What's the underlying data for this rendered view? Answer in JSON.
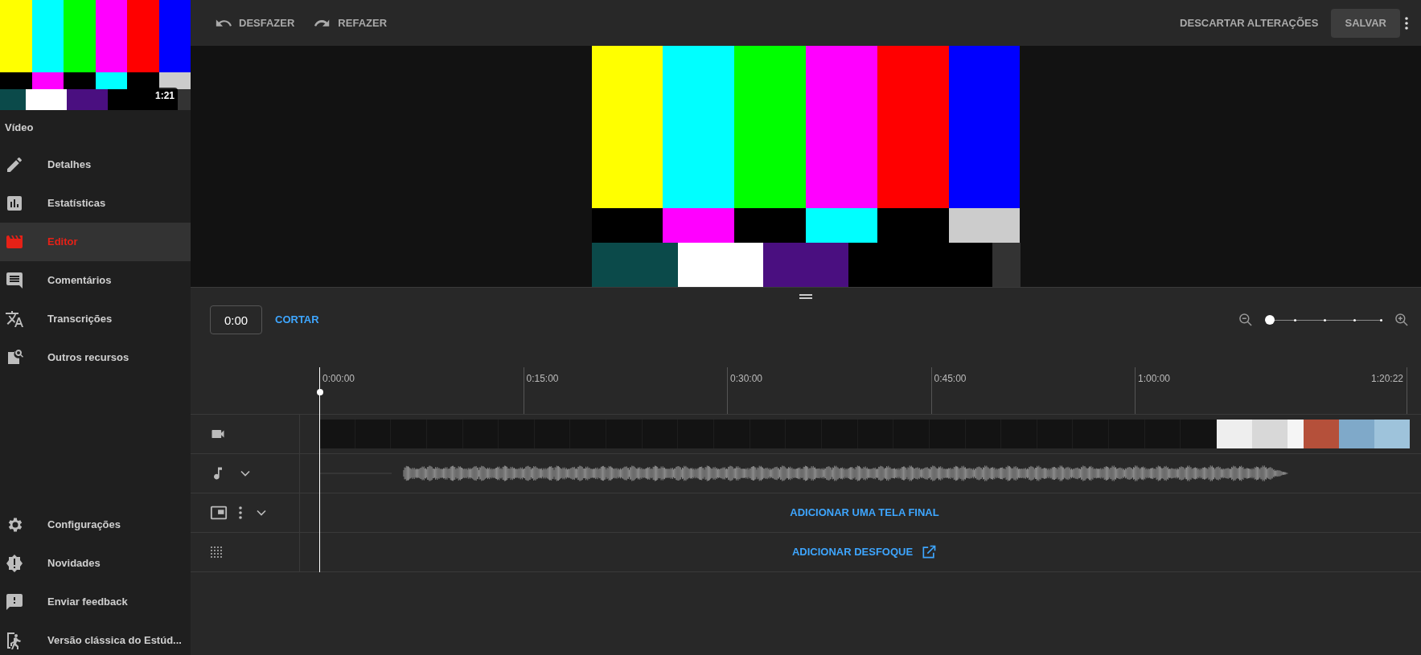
{
  "sidebar": {
    "video_thumbnail": {
      "duration": "1:21"
    },
    "section_title": "Vídeo",
    "items": [
      {
        "kind": "pencil",
        "label": "Detalhes",
        "selected": false
      },
      {
        "kind": "chart",
        "label": "Estatísticas",
        "selected": false
      },
      {
        "kind": "clapper",
        "label": "Editor",
        "selected": true
      },
      {
        "kind": "comment",
        "label": "Comentários",
        "selected": false
      },
      {
        "kind": "translate",
        "label": "Transcrições",
        "selected": false
      },
      {
        "kind": "search-doc",
        "label": "Outros recursos",
        "selected": false
      }
    ],
    "bottom_items": [
      {
        "kind": "gear",
        "label": "Configurações"
      },
      {
        "kind": "alert",
        "label": "Novidades"
      },
      {
        "kind": "feedback",
        "label": "Enviar feedback"
      },
      {
        "kind": "exit",
        "label": "Versão clássica do Estúd..."
      }
    ]
  },
  "toolbar": {
    "undo": "DESFAZER",
    "redo": "REFAZER",
    "discard": "DESCARTAR ALTERAÇÕES",
    "save": "SALVAR"
  },
  "timeline_controls": {
    "timecode": "0:00",
    "trim": "CORTAR",
    "zoom": {
      "level": 0
    }
  },
  "ruler": [
    "0:00:00",
    "0:15:00",
    "0:30:00",
    "0:45:00",
    "1:00:00",
    "1:20:22"
  ],
  "tracks": [
    {
      "kind": "video"
    },
    {
      "kind": "audio"
    },
    {
      "kind": "endscreen",
      "action": "ADICIONAR UMA TELA FINAL"
    },
    {
      "kind": "blur",
      "action": "ADICIONAR DESFOQUE"
    }
  ]
}
